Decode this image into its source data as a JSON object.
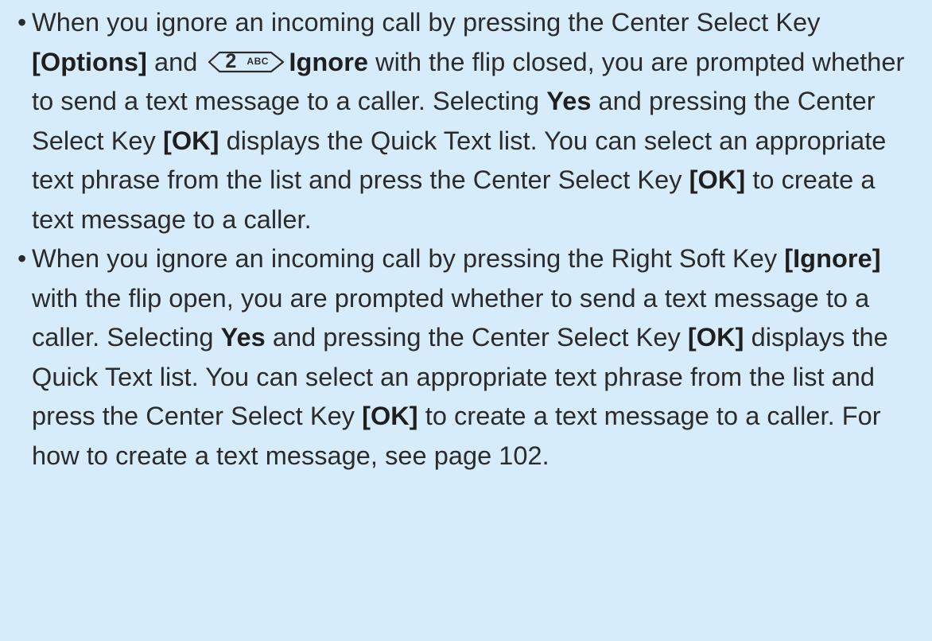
{
  "bullets": [
    {
      "t1": "When you ignore an incoming call by pressing the Center Select Key ",
      "b1": "[Options]",
      "t2": " and ",
      "key": {
        "digit": "2",
        "letters": "ABC",
        "icon": "dial-key-2-abc-icon"
      },
      "b2": "Ignore",
      "t3": " with the flip closed, you are prompted whether to send a text message to a caller. Selecting ",
      "b3": "Yes",
      "t4": " and pressing the Center Select Key ",
      "b4": "[OK]",
      "t5": " displays the Quick Text list. You can select an appropriate text phrase from the list and press the Center Select Key ",
      "b5": "[OK]",
      "t6": " to create a text message to a caller."
    },
    {
      "t1": "When you ignore an incoming call by pressing the Right Soft Key ",
      "b1": "[Ignore]",
      "t2": " with the flip open, you are prompted whether to send a text message to a caller. Selecting ",
      "b2": "Yes",
      "t3": " and pressing the Center Select Key ",
      "b3": "[OK]",
      "t4": " displays the Quick Text list. You can select an appropriate text phrase from the list and press the Center Select Key ",
      "b4": "[OK]",
      "t5": " to create a text message to a caller. For how to create a text message, see page 102."
    }
  ],
  "colors": {
    "background": "#d7ecfa",
    "text": "#2b2b2b"
  }
}
